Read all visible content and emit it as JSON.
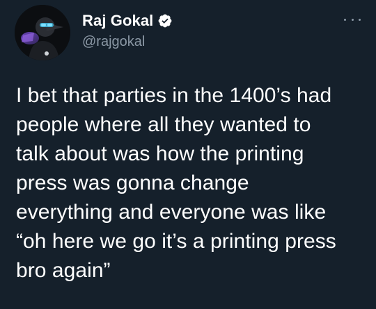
{
  "author": {
    "display_name": "Raj Gokal",
    "handle": "@rajgokal",
    "verified": true
  },
  "icons": {
    "avatar": "avatar-image",
    "verified": "verified-badge-icon",
    "more": "more-options-icon"
  },
  "tweet": {
    "lines": [
      "I bet that parties in the 1400’s had",
      "people where all they wanted to",
      "talk about was how the printing",
      "press was gonna change",
      "everything and everyone was like",
      "“oh here we go it’s a printing press",
      "bro again”"
    ]
  },
  "colors": {
    "background": "#15202b",
    "text": "#ffffff",
    "secondary_text": "#8b98a5",
    "verified": "#ffffff"
  }
}
